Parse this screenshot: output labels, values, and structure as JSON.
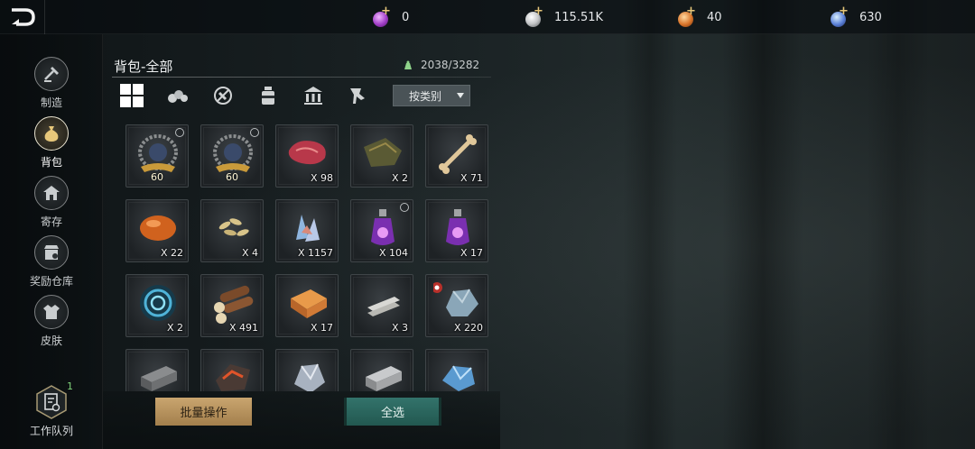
{
  "topbar": {
    "currencies": [
      {
        "icon": "purple-gem-icon",
        "value": "0",
        "color": "#a13ec7"
      },
      {
        "icon": "silver-coin-icon",
        "value": "115.51K",
        "color": "#c4c6c8"
      },
      {
        "icon": "orange-coin-icon",
        "value": "40",
        "color": "#d9752a"
      },
      {
        "icon": "blue-crystal-icon",
        "value": "630",
        "color": "#5a7fd6"
      }
    ]
  },
  "sidebar": {
    "items": [
      {
        "label": "制造",
        "icon": "hammer-icon",
        "active": false
      },
      {
        "label": "背包",
        "icon": "bag-icon",
        "active": true
      },
      {
        "label": "寄存",
        "icon": "storehouse-icon",
        "active": false
      },
      {
        "label": "奖励仓库",
        "icon": "reward-shop-icon",
        "active": false
      },
      {
        "label": "皮肤",
        "icon": "armor-icon",
        "active": false
      }
    ],
    "work_queue": {
      "label": "工作队列",
      "count": "1"
    }
  },
  "inventory": {
    "title": "背包-全部",
    "capacity": "2038/3282",
    "filters": [
      "all-grid-icon",
      "materials-icon",
      "no-weapon-icon",
      "potion-icon",
      "building-icon",
      "trophy-icon"
    ],
    "sort_label": "按类别",
    "items": [
      {
        "name": "wreath-emblem-lv60",
        "level": "60",
        "qty": "",
        "bound": true
      },
      {
        "name": "wreath-emblem-lv60",
        "level": "60",
        "qty": "",
        "bound": true
      },
      {
        "name": "raw-meat",
        "level": "",
        "qty": "X 98",
        "bound": false
      },
      {
        "name": "hide-scrap",
        "level": "",
        "qty": "X 2",
        "bound": false
      },
      {
        "name": "bone",
        "level": "",
        "qty": "X 71",
        "bound": false
      },
      {
        "name": "amber-resin",
        "level": "",
        "qty": "X 22",
        "bound": false
      },
      {
        "name": "seeds",
        "level": "",
        "qty": "X 4",
        "bound": false
      },
      {
        "name": "crystal-shards",
        "level": "",
        "qty": "X 1157",
        "bound": false
      },
      {
        "name": "purple-potion",
        "level": "",
        "qty": "X 104",
        "bound": true
      },
      {
        "name": "purple-potion",
        "level": "",
        "qty": "X 17",
        "bound": false
      },
      {
        "name": "blue-vortex",
        "level": "",
        "qty": "X 2",
        "bound": false
      },
      {
        "name": "logs",
        "level": "",
        "qty": "X 491",
        "bound": false
      },
      {
        "name": "planks",
        "level": "",
        "qty": "X 17",
        "bound": false
      },
      {
        "name": "metal-plates",
        "level": "",
        "qty": "X 3",
        "bound": false
      },
      {
        "name": "stone-ore",
        "level": "",
        "qty": "X 220",
        "bound": false
      },
      {
        "name": "iron-ingot",
        "level": "",
        "qty": "",
        "bound": false
      },
      {
        "name": "magma-ore",
        "level": "",
        "qty": "",
        "bound": false
      },
      {
        "name": "silver-ore",
        "level": "",
        "qty": "",
        "bound": false
      },
      {
        "name": "steel-ingot",
        "level": "",
        "qty": "",
        "bound": false
      },
      {
        "name": "blue-ore",
        "level": "",
        "qty": "",
        "bound": false
      }
    ]
  },
  "actions": {
    "batch_label": "批量操作",
    "select_all_label": "全选"
  }
}
